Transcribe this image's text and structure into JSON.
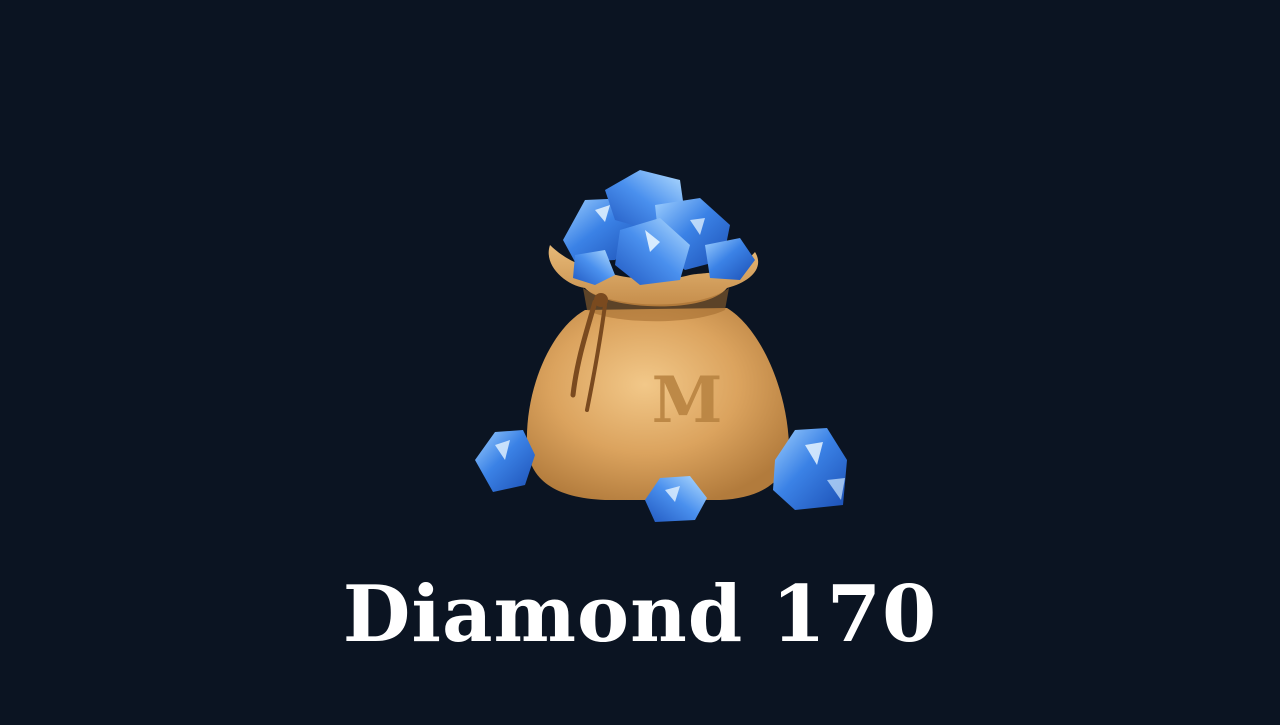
{
  "product": {
    "title": "Diamond 170",
    "bag_emblem": "M"
  },
  "icons": {
    "bag": "diamond-bag-icon",
    "gem": "blue-diamond-icon"
  },
  "colors": {
    "background": "#0b1422",
    "title": "#ffffff",
    "bag": "#d9a05a",
    "gem": "#3a7de0"
  }
}
